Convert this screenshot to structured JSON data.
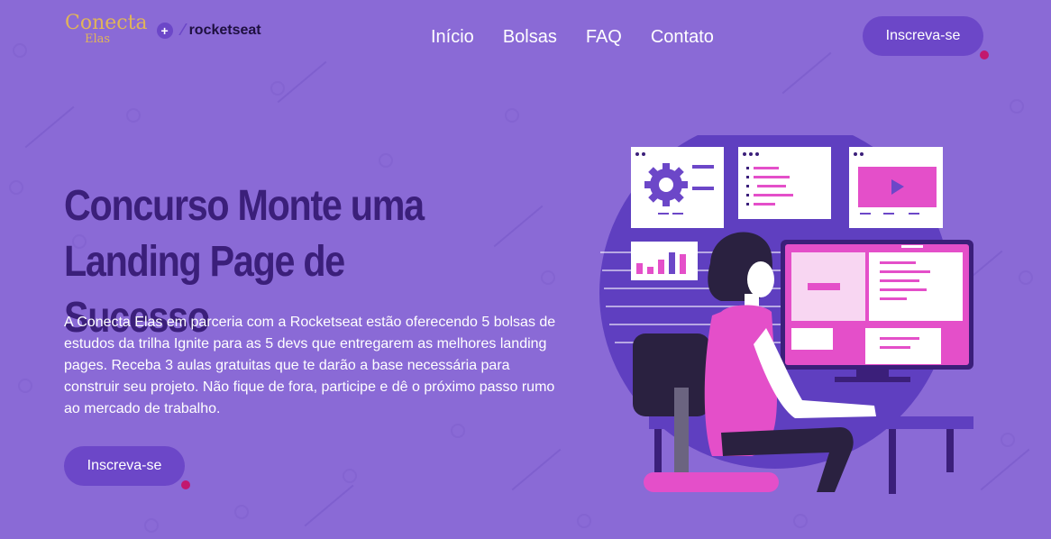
{
  "logo": {
    "conecta": "Conecta",
    "elas": "Elas",
    "plus": "+",
    "rocketseat": "rocketseat"
  },
  "nav": {
    "items": [
      "Início",
      "Bolsas",
      "FAQ",
      "Contato"
    ],
    "cta": "Inscreva-se"
  },
  "hero": {
    "title": "Concurso Monte uma Landing Page de Sucesso",
    "description": "A Conecta Elas em parceria com a Rocketseat estão oferecendo 5 bolsas de estudos da trilha Ignite para as 5 devs que entregarem as melhores landing pages. Receba 3 aulas gratuitas que te darão a base necessária para construir seu projeto. Não fique de fora, participe e dê o próximo passo rumo ao mercado de trabalho.",
    "cta": "Inscreva-se"
  },
  "colors": {
    "background": "#8a6ad6",
    "primary": "#6c47c8",
    "title": "#3b1f7a",
    "accent": "#e44fc9",
    "dot": "#c2186f",
    "logo_gold": "#e0b45a"
  },
  "icons": [
    "gear-icon",
    "play-icon",
    "bar-chart-icon"
  ]
}
